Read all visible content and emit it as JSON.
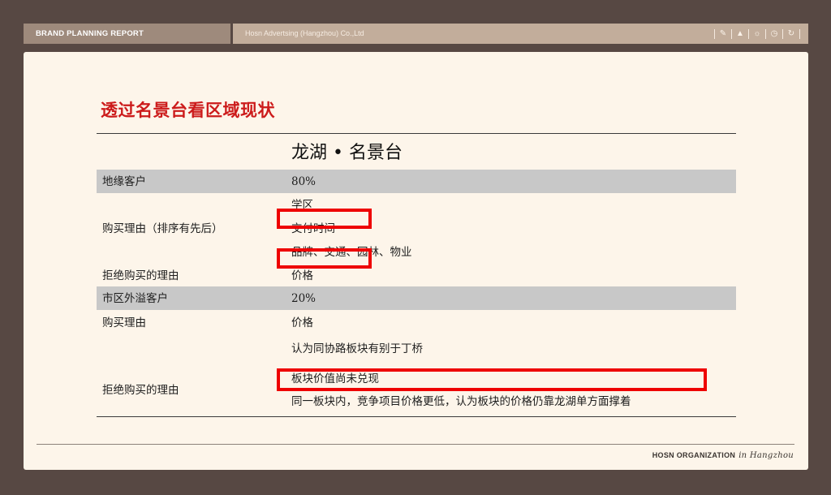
{
  "header": {
    "report_title": "BRAND PLANNING REPORT",
    "company": "Hosn Advertsing (Hangzhou) Co.,Ltd",
    "icons": [
      "pencil-icon",
      "lamp-icon",
      "sun-icon",
      "clock-icon",
      "refresh-icon"
    ]
  },
  "slide": {
    "title": "透过名景台看区域现状",
    "column_header": "龙湖 • 名景台",
    "rows": {
      "r1_label": "地缘客户",
      "r1_value": "80%",
      "r2_label": "购买理由（排序有先后）",
      "r2_v1": "学区",
      "r2_v2": "交付时间",
      "r2_v3": "品牌、交通、园林、物业",
      "r3_label": "拒绝购买的理由",
      "r3_value": "价格",
      "r4_label": "市区外溢客户",
      "r4_value": "20%",
      "r5_label": "购买理由",
      "r5_value": "价格",
      "r6_label": "拒绝购买的理由",
      "r6_v1": "认为同协路板块有别于丁桥",
      "r6_v2": "板块价值尚未兑现",
      "r6_v3": "同一板块内，竞争项目价格更低，认为板块的价格仍靠龙湖单方面撑着"
    }
  },
  "footer": {
    "org": "HOSN ORGANIZATION",
    "city": "in Hangzhou"
  },
  "colors": {
    "background": "#574843",
    "slide": "#fdf5ea",
    "title": "#cc1b1b",
    "band": "#c8c8c8",
    "highlight": "#ee0000"
  }
}
